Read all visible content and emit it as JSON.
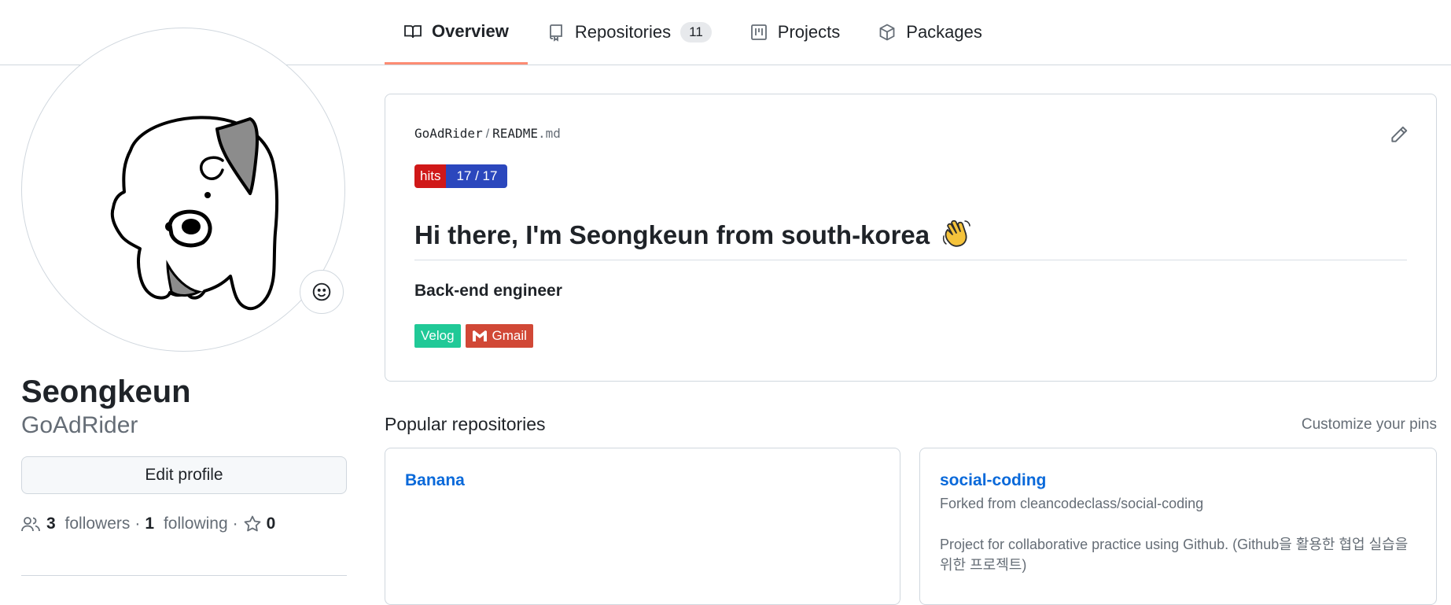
{
  "tabs": [
    {
      "label": "Overview",
      "icon": "book-icon",
      "active": true
    },
    {
      "label": "Repositories",
      "icon": "repo-icon",
      "count": "11"
    },
    {
      "label": "Projects",
      "icon": "project-icon"
    },
    {
      "label": "Packages",
      "icon": "package-icon"
    }
  ],
  "profile": {
    "name": "Seongkeun",
    "login": "GoAdRider",
    "edit_label": "Edit profile",
    "followers_count": "3",
    "followers_label": "followers",
    "separator": "·",
    "following_count": "1",
    "following_label": "following",
    "stars_count": "0"
  },
  "readme": {
    "owner": "GoAdRider",
    "path_sep": "/",
    "file_base": "README",
    "file_ext": ".md",
    "hits_label": "hits",
    "hits_value": "17 / 17",
    "heading": "Hi there, I'm Seongkeun from south-korea",
    "subtitle": "Back-end engineer",
    "badges": {
      "velog": "Velog",
      "gmail": "Gmail"
    }
  },
  "popular": {
    "title": "Popular repositories",
    "customize": "Customize your pins",
    "repos": [
      {
        "name": "Banana"
      },
      {
        "name": "social-coding",
        "forked": "Forked from cleancodeclass/social-coding",
        "description": "Project for collaborative practice using Github. (Github을 활용한 협업 실습을 위한 프로젝트)"
      }
    ]
  },
  "colors": {
    "accent": "#fd8c73",
    "link": "#0969da",
    "hits_left": "#d01818",
    "hits_right": "#2b47bd",
    "velog": "#20c997",
    "gmail": "#d14836"
  }
}
